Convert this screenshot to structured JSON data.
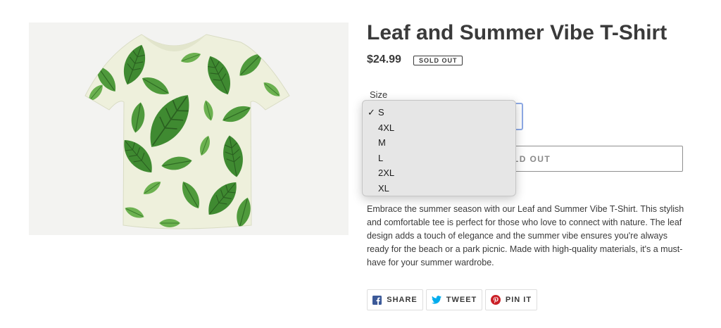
{
  "product": {
    "title": "Leaf and Summer Vibe T-Shirt",
    "price": "$24.99",
    "badge": "SOLD OUT",
    "size_label": "Size",
    "selected_size": "S",
    "size_options": [
      "S",
      "4XL",
      "M",
      "L",
      "2XL",
      "XL"
    ],
    "checkmark": "✓",
    "button_label": "SOLD OUT",
    "description": "Embrace the summer season with our Leaf and Summer Vibe T-Shirt. This stylish and comfortable tee is perfect for those who love to connect with nature. The leaf design adds a touch of elegance and the summer vibe ensures you're always ready for the beach or a park picnic. Made with high-quality materials, it's a must-have for your summer wardrobe."
  },
  "share": {
    "facebook": "SHARE",
    "twitter": "TWEET",
    "pinterest": "PIN IT"
  },
  "colors": {
    "text": "#3a3a3a",
    "facebook": "#3b5998",
    "twitter": "#00aced",
    "pinterest": "#cb2027",
    "focus_ring": "#8eaae6",
    "leaf_green": "#4f9a3c",
    "shirt_base": "#eef0dc"
  },
  "icons": [
    "facebook-icon",
    "twitter-icon",
    "pinterest-icon",
    "checkmark-icon"
  ]
}
